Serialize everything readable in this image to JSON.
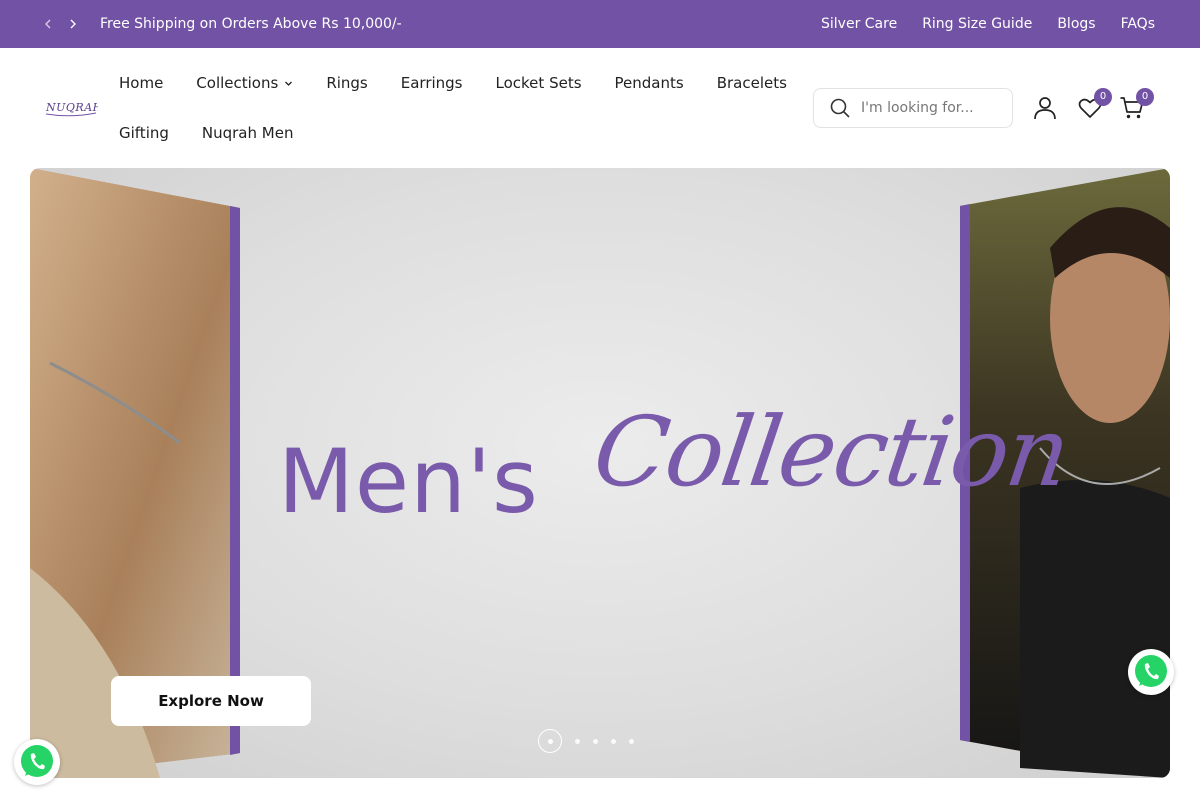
{
  "topbar": {
    "promo": "Free Shipping on Orders Above Rs 10,000/-",
    "links": [
      "Silver Care",
      "Ring Size Guide",
      "Blogs",
      "FAQs"
    ]
  },
  "brand": {
    "logo_text": "NUQRAH",
    "accent": "#7252a4"
  },
  "nav": {
    "row1": [
      "Home",
      "Collections",
      "Rings",
      "Earrings",
      "Locket Sets",
      "Pendants",
      "Bracelets"
    ],
    "row2": [
      "Gifting",
      "Nuqrah Men"
    ]
  },
  "search": {
    "placeholder": "I'm looking for..."
  },
  "header_icons": {
    "wishlist_count": "0",
    "cart_count": "0"
  },
  "hero": {
    "headline": "Men's",
    "script": "Collection",
    "cta": "Explore Now",
    "slide_count": 5,
    "active_slide": 1
  },
  "icons": [
    "chevron-left-icon",
    "chevron-right-icon",
    "chevron-down-icon",
    "search-icon",
    "user-icon",
    "heart-icon",
    "cart-icon",
    "whatsapp-icon"
  ]
}
